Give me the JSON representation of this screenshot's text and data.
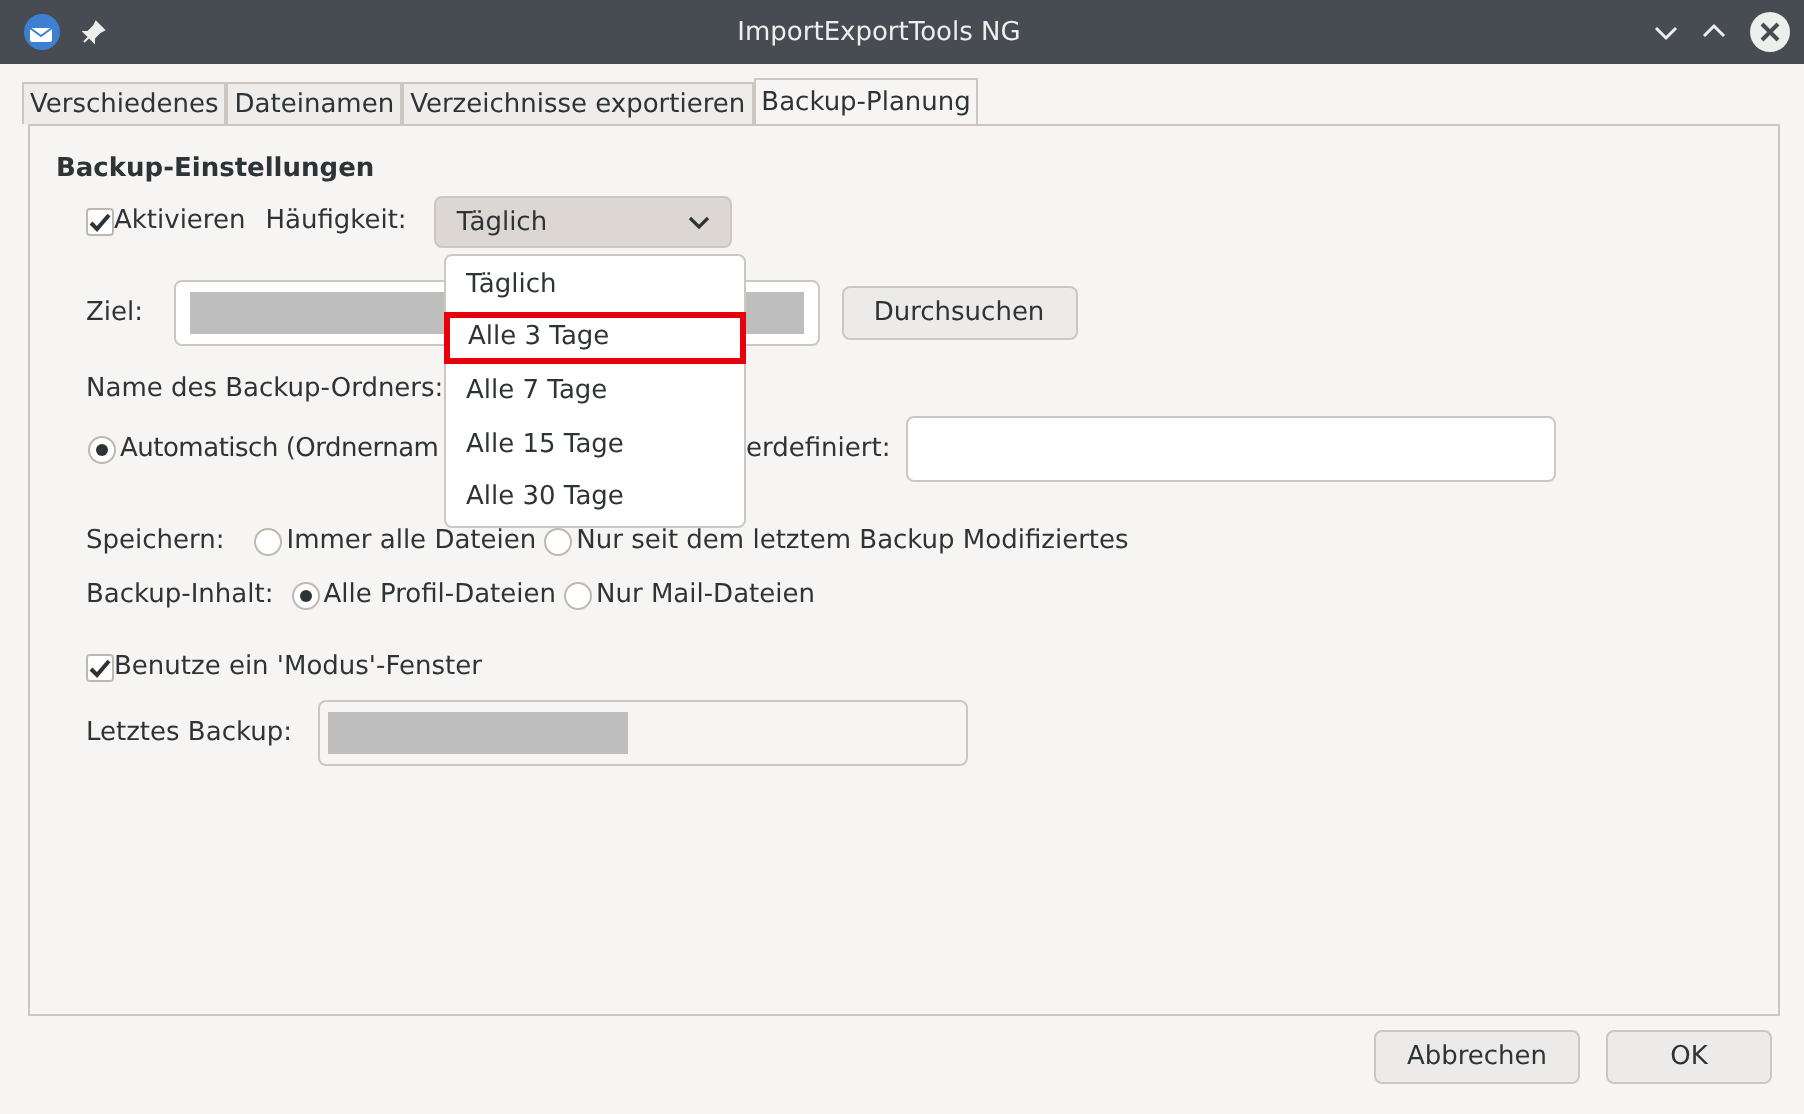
{
  "window": {
    "title": "ImportExportTools NG"
  },
  "tabs": [
    {
      "label": "Verschiedenes",
      "selected": false
    },
    {
      "label": "Dateinamen",
      "selected": false
    },
    {
      "label": "Verzeichnisse exportieren",
      "selected": false
    },
    {
      "label": "Backup-Planung",
      "selected": true
    }
  ],
  "section_title": "Backup-Einstellungen",
  "activate": {
    "label": "Aktivieren",
    "checked": true
  },
  "frequency": {
    "label": "Häufigkeit:",
    "value": "Täglich"
  },
  "frequency_menu": [
    {
      "label": "Täglich",
      "selected": false
    },
    {
      "label": "Alle 3 Tage",
      "selected": true
    },
    {
      "label": "Alle 7 Tage",
      "selected": false
    },
    {
      "label": "Alle 15 Tage",
      "selected": false
    },
    {
      "label": "Alle 30 Tage",
      "selected": false
    }
  ],
  "target": {
    "label": "Ziel:",
    "button": "Durchsuchen"
  },
  "folder_name_label": "Name des Backup-Ordners:",
  "folder_mode": {
    "label": "Automatisch (Ordnernam",
    "selected": true,
    "custom_label": "erdefiniert:"
  },
  "save": {
    "label": "Speichern:",
    "options": [
      {
        "label": "Immer alle Dateien",
        "selected": false
      },
      {
        "label": "Nur seit dem letztem Backup Modifiziertes",
        "selected": false
      }
    ]
  },
  "backup_content": {
    "label": "Backup-Inhalt:",
    "options": [
      {
        "label": "Alle Profil-Dateien",
        "selected": true
      },
      {
        "label": "Nur Mail-Dateien",
        "selected": false
      }
    ]
  },
  "modal_window": {
    "label": "Benutze ein 'Modus'-Fenster",
    "checked": true
  },
  "last_backup": {
    "label": "Letztes Backup:"
  },
  "buttons": [
    "Abbrechen",
    "OK"
  ]
}
